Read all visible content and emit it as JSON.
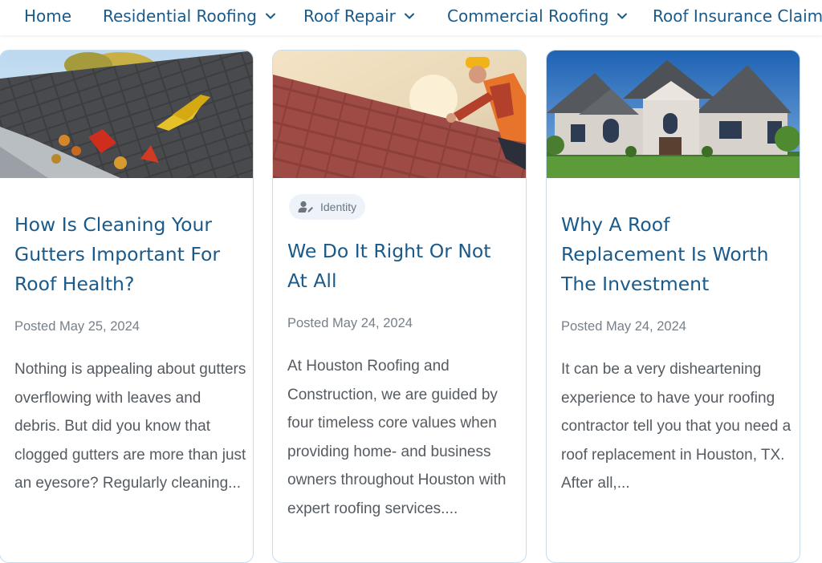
{
  "nav": {
    "items": [
      {
        "label": "Home",
        "has_dropdown": false
      },
      {
        "label": "Residential Roofing",
        "has_dropdown": true
      },
      {
        "label": "Roof Repair",
        "has_dropdown": true
      },
      {
        "label": "Commercial Roofing",
        "has_dropdown": true
      },
      {
        "label": "Roof Insurance Claims",
        "has_dropdown": false
      }
    ]
  },
  "posts": [
    {
      "image_alt": "Roof shingles with a leaf-filled gutter",
      "category": "",
      "title": "How Is Cleaning Your Gutters Important For Roof Health?",
      "date": "Posted May 25, 2024",
      "excerpt": "Nothing is appealing about gutters overflowing with leaves and debris. But did you know that clogged gutters are more than just an eyesore? Regularly cleaning..."
    },
    {
      "image_alt": "Roofer in hard hat working on a tile roof",
      "category": "Identity",
      "category_icon": "user-edit-icon",
      "title": "We Do It Right Or Not At All",
      "date": "Posted May 24, 2024",
      "excerpt": "At Houston Roofing and Construction, we are guided by four timeless core values when providing home- and business owners throughout Houston with expert roofing services...."
    },
    {
      "image_alt": "Large brick house with new roof",
      "category": "",
      "title": "Why A Roof Replacement Is Worth The Investment",
      "date": "Posted May 24, 2024",
      "excerpt": "It can be a very disheartening experience to have your roofing contractor tell you that you need a roof replacement in Houston, TX. After all,..."
    }
  ],
  "colors": {
    "link_blue": "#1a5a8a",
    "card_border": "#c9dcec",
    "badge_bg": "#edf3f9",
    "date_gray": "#77808a",
    "body_text": "#555b61"
  }
}
